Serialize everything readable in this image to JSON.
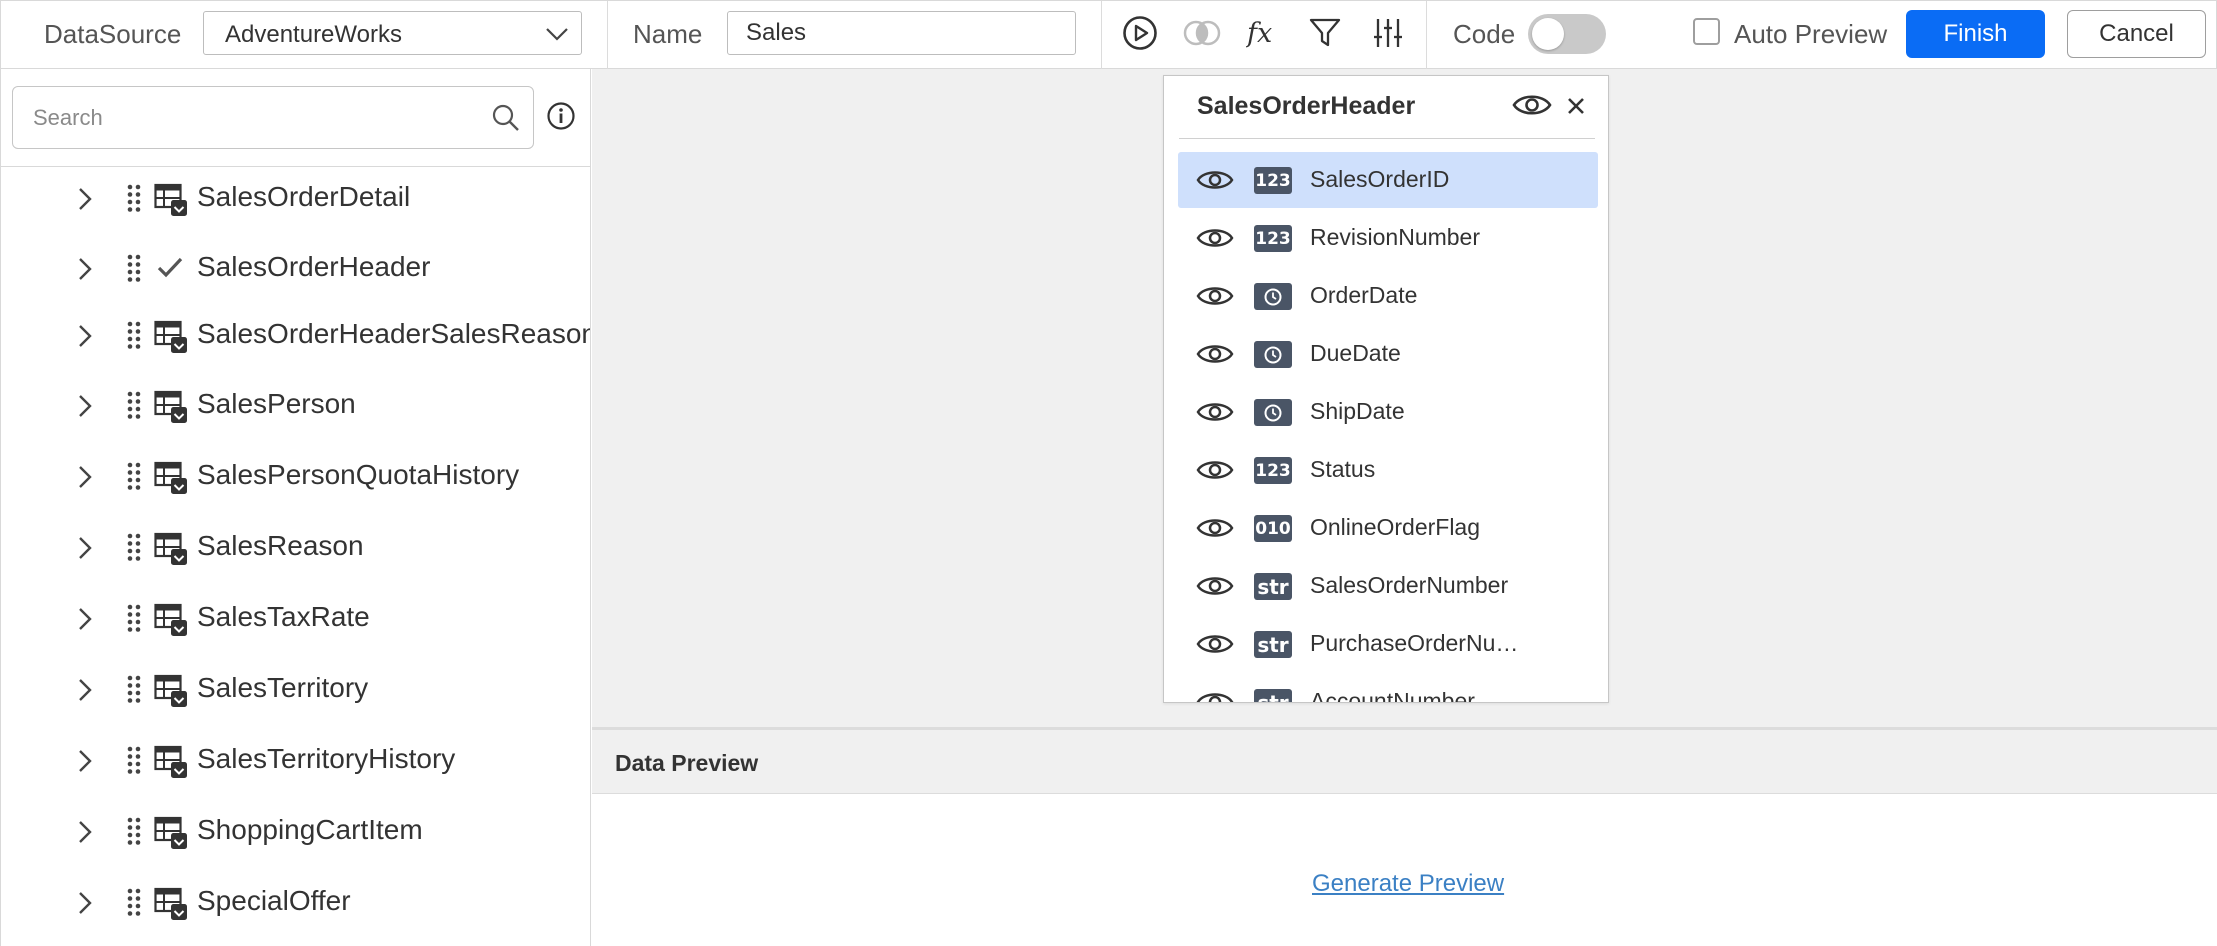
{
  "toolbar": {
    "datasource_label": "DataSource",
    "datasource_value": "AdventureWorks",
    "name_label": "Name",
    "name_value": "Sales",
    "code_label": "Code",
    "code_enabled": false,
    "auto_preview_label": "Auto Preview",
    "auto_preview_checked": false,
    "finish_label": "Finish",
    "cancel_label": "Cancel",
    "icons": [
      "play-icon",
      "join-icon",
      "fx-icon",
      "filter-icon",
      "sliders-icon"
    ]
  },
  "left_panel": {
    "search_placeholder": "Search",
    "tree_items": [
      {
        "label": "SalesOrderDetail",
        "icon": "table-icon"
      },
      {
        "label": "SalesOrderHeader",
        "icon": "checkmark-icon"
      },
      {
        "label": "SalesOrderHeaderSalesReason",
        "icon": "table-icon"
      },
      {
        "label": "SalesPerson",
        "icon": "table-icon"
      },
      {
        "label": "SalesPersonQuotaHistory",
        "icon": "table-icon"
      },
      {
        "label": "SalesReason",
        "icon": "table-icon"
      },
      {
        "label": "SalesTaxRate",
        "icon": "table-icon"
      },
      {
        "label": "SalesTerritory",
        "icon": "table-icon"
      },
      {
        "label": "SalesTerritoryHistory",
        "icon": "table-icon"
      },
      {
        "label": "ShoppingCartItem",
        "icon": "table-icon"
      },
      {
        "label": "SpecialOffer",
        "icon": "table-icon"
      }
    ]
  },
  "table_card": {
    "title": "SalesOrderHeader",
    "columns": [
      {
        "label": "SalesOrderID",
        "type": "123",
        "selected": true
      },
      {
        "label": "RevisionNumber",
        "type": "123"
      },
      {
        "label": "OrderDate",
        "type": "clock"
      },
      {
        "label": "DueDate",
        "type": "clock"
      },
      {
        "label": "ShipDate",
        "type": "clock"
      },
      {
        "label": "Status",
        "type": "123"
      },
      {
        "label": "OnlineOrderFlag",
        "type": "010"
      },
      {
        "label": "SalesOrderNumber",
        "type": "str"
      },
      {
        "label": "PurchaseOrderNu…",
        "type": "str"
      },
      {
        "label": "AccountNumber",
        "type": "str"
      }
    ]
  },
  "data_preview": {
    "title": "Data Preview",
    "generate_label": "Generate Preview"
  },
  "colors": {
    "accent": "#0a6cf5",
    "selected_row": "#cfe0fc",
    "badge": "#4a5566",
    "link": "#3b80c4",
    "canvas_bg": "#f0f0f0"
  }
}
